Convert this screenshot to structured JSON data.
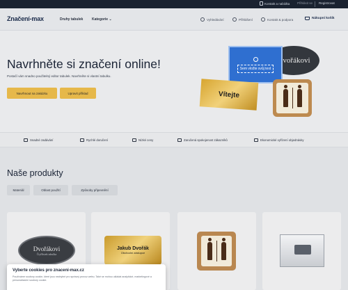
{
  "topbar": {
    "contact_label": "Kontakt a nabídka",
    "login_label": "Přihlásit se",
    "register_label": "Registrovat"
  },
  "header": {
    "logo": "Značení-max",
    "nav": [
      "Druhy tabulek",
      "Kategorie"
    ],
    "search_label": "Vyhledávání",
    "account_label": "Přihlášení",
    "help_label": "Kontakt & podpora",
    "cart_label": "Nákupní košík"
  },
  "hero": {
    "title": "Navrhněte si značení online!",
    "subtitle": "Postačí vám snadno použitelný editor tabulek. Navrhněte si vlastní tabulku.",
    "primary_button": "Navrhnout na zakázku",
    "secondary_button": "Upravit příklad",
    "sign_oval_text": "Dvořákovi",
    "sign_blue_text": "Sem vložte svůj text",
    "sign_gold_text": "Vítejte"
  },
  "features": [
    "Snadné zadávání",
    "Rychlé doručení",
    "Nízké ceny",
    "Zaručená spokojenost zákazníků",
    "Ekonomické vyřízení objednávky"
  ],
  "products": {
    "title": "Naše produkty",
    "filters": [
      "Materiál",
      "Oblast použití",
      "Způsoby připevnění"
    ],
    "card1_name": "Dvořákovi",
    "card1_sub": "Čtyřlístek tabulka",
    "card2_name": "Jakub Dvořák",
    "card2_sub": "Obchodní zástupce"
  },
  "cookie": {
    "title": "Vyberte cookies pro znaceni-max.cz",
    "text": "Používáme soubory cookie, které jsou nezbytné pro správný provoz webu. Také se mohou ukládat analytické, marketingové a personalizační soubory cookie."
  }
}
